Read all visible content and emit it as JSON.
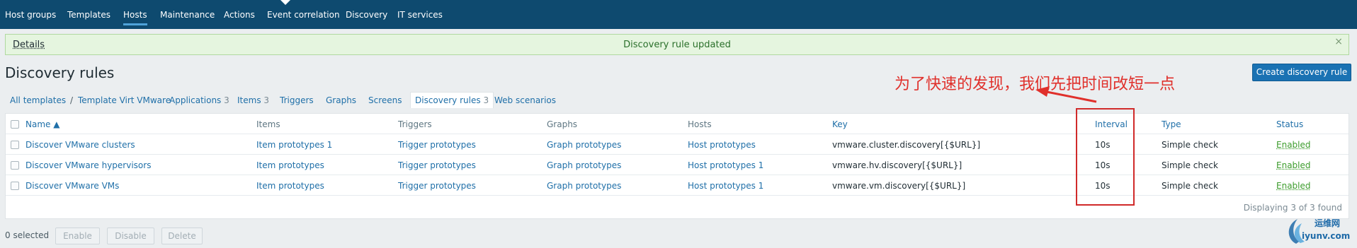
{
  "topnav": {
    "items": [
      "Host groups",
      "Templates",
      "Hosts",
      "Maintenance",
      "Actions",
      "Event correlation",
      "Discovery",
      "IT services"
    ],
    "active": "Hosts"
  },
  "message": {
    "details_label": "Details",
    "text": "Discovery rule updated",
    "close": "×"
  },
  "page": {
    "title": "Discovery rules",
    "create_button": "Create discovery rule"
  },
  "breadcrumbs": {
    "all_templates": "All templates",
    "separator": "/",
    "template": "Template Virt VMware",
    "tabs": [
      {
        "label": "Applications",
        "count": "3"
      },
      {
        "label": "Items",
        "count": "3"
      },
      {
        "label": "Triggers",
        "count": ""
      },
      {
        "label": "Graphs",
        "count": ""
      },
      {
        "label": "Screens",
        "count": ""
      },
      {
        "label": "Discovery rules",
        "count": "3"
      },
      {
        "label": "Web scenarios",
        "count": ""
      }
    ],
    "active_tab": "Discovery rules"
  },
  "table": {
    "headers": {
      "name": "Name ▲",
      "items": "Items",
      "triggers": "Triggers",
      "graphs": "Graphs",
      "hosts": "Hosts",
      "key": "Key",
      "interval": "Interval",
      "type": "Type",
      "status": "Status"
    },
    "rows": [
      {
        "name": "Discover VMware clusters",
        "items": "Item prototypes 1",
        "triggers": "Trigger prototypes",
        "graphs": "Graph prototypes",
        "hosts": "Host prototypes",
        "key": "vmware.cluster.discovery[{$URL}]",
        "interval": "10s",
        "type": "Simple check",
        "status": "Enabled"
      },
      {
        "name": "Discover VMware hypervisors",
        "items": "Item prototypes",
        "triggers": "Trigger prototypes",
        "graphs": "Graph prototypes",
        "hosts": "Host prototypes 1",
        "key": "vmware.hv.discovery[{$URL}]",
        "interval": "10s",
        "type": "Simple check",
        "status": "Enabled"
      },
      {
        "name": "Discover VMware VMs",
        "items": "Item prototypes",
        "triggers": "Trigger prototypes",
        "graphs": "Graph prototypes",
        "hosts": "Host prototypes 1",
        "key": "vmware.vm.discovery[{$URL}]",
        "interval": "10s",
        "type": "Simple check",
        "status": "Enabled"
      }
    ],
    "footer": "Displaying 3 of 3 found"
  },
  "mass_actions": {
    "selected": "0 selected",
    "enable": "Enable",
    "disable": "Disable",
    "delete": "Delete"
  },
  "annotation": {
    "text": "为了快速的发现，我们先把时间改短一点",
    "color": "#e0302b"
  },
  "watermark": {
    "cn": "运维网",
    "en": "iyunv.com"
  },
  "colors": {
    "nav_bg": "#0e4a6f",
    "link": "#1f6fa8",
    "enabled": "#3c9c2c",
    "primary_button": "#1a72b3",
    "success_bg": "#e5f5df"
  }
}
